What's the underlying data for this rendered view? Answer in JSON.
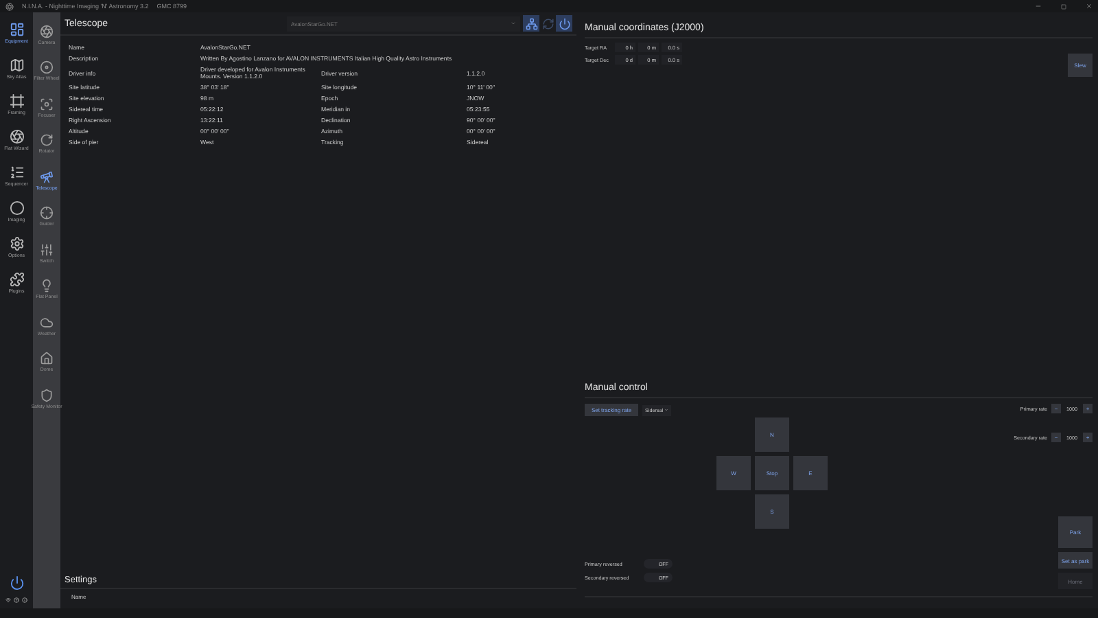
{
  "window": {
    "title": "N.I.N.A. - Nighttime Imaging 'N' Astronomy 3.2",
    "profile": "GMC 8799"
  },
  "nav": [
    {
      "label": "Equipment",
      "selected": true
    },
    {
      "label": "Sky Atlas",
      "selected": false
    },
    {
      "label": "Framing",
      "selected": false
    },
    {
      "label": "Flat Wizard",
      "selected": false
    },
    {
      "label": "Sequencer",
      "selected": false
    },
    {
      "label": "Imaging",
      "selected": false
    },
    {
      "label": "Options",
      "selected": false
    },
    {
      "label": "Plugins",
      "selected": false
    }
  ],
  "subnav": [
    {
      "label": "Camera",
      "selected": false
    },
    {
      "label": "Filter Wheel",
      "selected": false
    },
    {
      "label": "Focuser",
      "selected": false
    },
    {
      "label": "Rotator",
      "selected": false
    },
    {
      "label": "Telescope",
      "selected": true
    },
    {
      "label": "Guider",
      "selected": false
    },
    {
      "label": "Switch",
      "selected": false
    },
    {
      "label": "Flat Panel",
      "selected": false
    },
    {
      "label": "Weather",
      "selected": false
    },
    {
      "label": "Dome",
      "selected": false
    },
    {
      "label": "Safety Monitor",
      "selected": false
    }
  ],
  "telescope": {
    "title": "Telescope",
    "device": "AvalonStarGo.NET",
    "rows": [
      {
        "label": "Name",
        "value": "AvalonStarGo.NET"
      },
      {
        "label": "Description",
        "value": "Written By Agostino Lanzano for AVALON INSTRUMENTS Italian High Quality Astro Instruments"
      },
      {
        "label": "Driver info",
        "value": "Driver developed for Avalon Instruments Mounts. Version 1.1.2.0",
        "label2": "Driver version",
        "value2": "1.1.2.0"
      },
      {
        "label": "Site latitude",
        "value": "38° 03' 18\"",
        "label2": "Site longitude",
        "value2": "10° 11' 00\""
      },
      {
        "label": "Site elevation",
        "value": "98 m",
        "label2": "Epoch",
        "value2": "JNOW"
      },
      {
        "label": "Sidereal time",
        "value": "05:22:12",
        "label2": "Meridian in",
        "value2": "05:23:55"
      },
      {
        "label": "Right Ascension",
        "value": "13:22:11",
        "label2": "Declination",
        "value2": "90° 00' 00\""
      },
      {
        "label": "Altitude",
        "value": "00° 00' 00\"",
        "label2": "Azimuth",
        "value2": "00° 00' 00\""
      },
      {
        "label": "Side of pier",
        "value": "West",
        "label2": "Tracking",
        "value2": "Sidereal"
      }
    ]
  },
  "settings": {
    "title": "Settings",
    "columns": [
      "Name"
    ]
  },
  "manual_coordinates": {
    "title": "Manual coordinates (J2000)",
    "fields": [
      {
        "label": "Target RA",
        "parts": [
          {
            "value": "0",
            "unit": "h"
          },
          {
            "value": "0",
            "unit": "m"
          },
          {
            "value": "0.0",
            "unit": "s"
          }
        ]
      },
      {
        "label": "Target Dec",
        "parts": [
          {
            "value": "0",
            "unit": "d"
          },
          {
            "value": "0",
            "unit": "m"
          },
          {
            "value": "0.0",
            "unit": "s"
          }
        ]
      }
    ],
    "slew": "Slew"
  },
  "manual_control": {
    "title": "Manual control",
    "tracking_button": "Set tracking rate",
    "tracking_rate": "Sidereal",
    "rates": [
      {
        "label": "Primary rate",
        "value": "1000",
        "minus": "−",
        "plus": "+"
      },
      {
        "label": "Secondary rate",
        "value": "1000",
        "minus": "−",
        "plus": "+"
      }
    ],
    "directions": {
      "north": "N",
      "west": "W",
      "stop": "Stop",
      "east": "E",
      "south": "S"
    },
    "toggles": [
      {
        "label": "Primary reversed",
        "on": false,
        "text": "OFF"
      },
      {
        "label": "Secondary reversed",
        "on": false,
        "text": "OFF"
      }
    ],
    "actions": [
      {
        "label": "Park",
        "disabled": false
      },
      {
        "label": "Set as park",
        "disabled": false
      },
      {
        "label": "Home",
        "disabled": true
      }
    ]
  }
}
